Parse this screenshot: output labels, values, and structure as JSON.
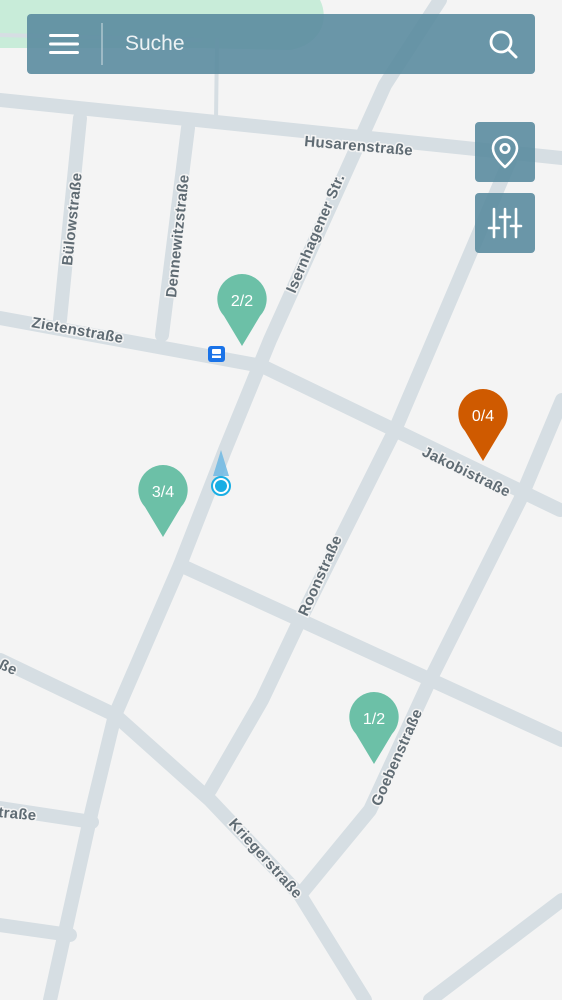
{
  "search": {
    "placeholder": "Suche"
  },
  "icons": {
    "menu": "menu-icon",
    "search": "search-icon",
    "location": "map-pin-icon",
    "filter": "sliders-icon",
    "bus_stop": "bus-stop-icon"
  },
  "colors": {
    "toolbar": "#5d8da1",
    "available_marker": "#6cc0a7",
    "full_marker": "#cf5a00",
    "user_location": "#19aee4",
    "road": "#d6dee3",
    "park": "#bfead3",
    "map_background": "#f4f4f4"
  },
  "streets": {
    "husarenstrasse": "Husarenstraße",
    "buelowstrasse": "Bülowstraße",
    "dennewitzstrasse": "Dennewitzstraße",
    "isernhagener": "Isernhagener Str.",
    "zietenstrasse": "Zietenstraße",
    "jakobistrasse": "Jakobistraße",
    "roonstrasse": "Roonstraße",
    "goebenstrasse": "Goebenstraße",
    "kriegerstrasse": "Kriegerstraße",
    "left_fragment_1": "ße",
    "left_fragment_2": "traße"
  },
  "markers": [
    {
      "label": "2/2",
      "status": "available"
    },
    {
      "label": "3/4",
      "status": "available"
    },
    {
      "label": "0/4",
      "status": "full"
    },
    {
      "label": "1/2",
      "status": "available"
    }
  ]
}
